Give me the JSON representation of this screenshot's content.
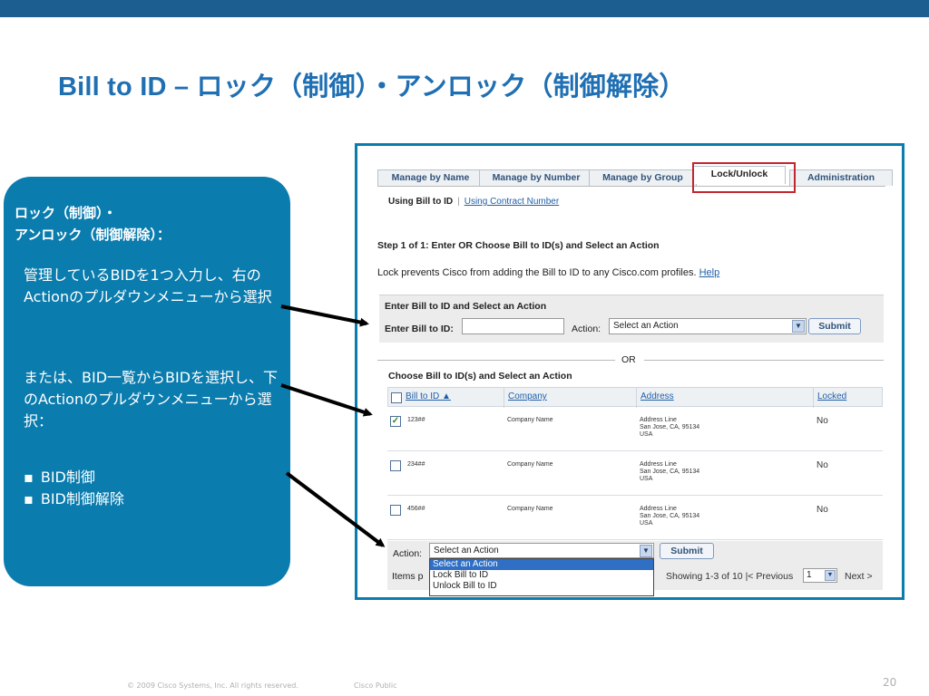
{
  "slide": {
    "title": "Bill to ID – ロック（制御）・アンロック（制御解除）",
    "panel_header_line1": "ロック（制御）・",
    "panel_header_line2": "アンロック（制御解除）：",
    "para1": "管理しているBIDを1つ入力し、右のActionのプルダウンメニューから選択",
    "para2": "または、BID一覧からBIDを選択し、下のActionのプルダウンメニューから選択：",
    "bullets": [
      "BID制御",
      "BID制御解除"
    ],
    "footer_copyright": "© 2009 Cisco Systems, Inc. All rights reserved.",
    "footer_classification": "Cisco Public",
    "page_number": "20",
    "colors": {
      "top_bar": "#1b5e8f",
      "title": "#1f6fb3",
      "panel": "#0a7cae",
      "highlight": "#c0272d"
    }
  },
  "screenshot": {
    "tabs": [
      "Manage by Name",
      "Manage by Number",
      "Manage by Group",
      "Lock/Unlock",
      "Administration"
    ],
    "active_tab": "Lock/Unlock",
    "sub_nav": {
      "active": "Using Bill to ID",
      "link": "Using Contract Number"
    },
    "step": "Step 1 of 1: Enter OR Choose Bill to ID(s) and Select an Action",
    "info_text": "Lock prevents Cisco from adding the Bill to ID to any Cisco.com profiles.",
    "help_link": "Help",
    "enter_box": {
      "header": "Enter Bill to ID and Select an Action",
      "bid_label": "Enter Bill to ID:",
      "action_label": "Action:",
      "action_value": "Select an Action",
      "submit": "Submit"
    },
    "or_text": "OR",
    "choose_header": "Choose Bill to ID(s) and Select an Action",
    "table": {
      "columns": [
        "Bill to ID ▲",
        "Company",
        "Address",
        "Locked"
      ],
      "rows": [
        {
          "checked": true,
          "bid": "123##",
          "company": "Company Name",
          "addr1": "Address Line",
          "addr2": "San Jose, CA, 95134",
          "addr3": "USA",
          "locked": "No"
        },
        {
          "checked": false,
          "bid": "234##",
          "company": "Company Name",
          "addr1": "Address Line",
          "addr2": "San Jose, CA, 95134",
          "addr3": "USA",
          "locked": "No"
        },
        {
          "checked": false,
          "bid": "456##",
          "company": "Company Name",
          "addr1": "Address Line",
          "addr2": "San Jose, CA, 95134",
          "addr3": "USA",
          "locked": "No"
        }
      ]
    },
    "bottom_action": {
      "label": "Action:",
      "value": "Select an Action",
      "submit": "Submit",
      "options": [
        "Select an Action",
        "Lock Bill to ID",
        "Unlock Bill to ID"
      ],
      "highlighted_option": "Select an Action"
    },
    "items_per_page_partial": "Items p",
    "showing": "Showing 1-3 of 10",
    "previous": "|< Previous",
    "page_select": "1",
    "next": "Next >"
  }
}
